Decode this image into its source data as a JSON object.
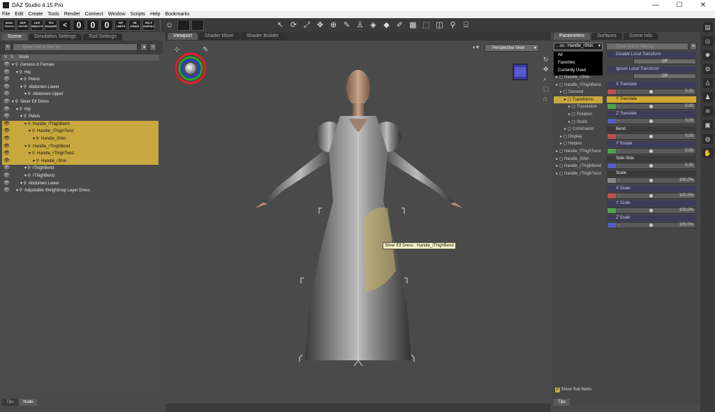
{
  "app": {
    "title": "DAZ Studio 4.15 Pro"
  },
  "window_controls": {
    "minimize": "—",
    "maximize": "☐",
    "close": "✕"
  },
  "menu": [
    "File",
    "Edit",
    "Create",
    "Tools",
    "Render",
    "Connect",
    "Window",
    "Scripts",
    "Help",
    "Bookmarks"
  ],
  "toolbar_buttons": [
    {
      "label": "MAIN TOOLS"
    },
    {
      "label": "MDF CSTOP"
    },
    {
      "label": "LIKE SMOOTH"
    },
    {
      "label": "TEX SHADER"
    },
    {
      "label": "<"
    },
    {
      "label": "0"
    },
    {
      "label": "0"
    },
    {
      "label": "0"
    },
    {
      "label": "HIP LIMITS"
    },
    {
      "label": "SB GRIDS"
    },
    {
      "label": "HELP SURFACE"
    }
  ],
  "left_panel": {
    "tabs": [
      "Scene",
      "Simulation Settings",
      "Tool Settings"
    ],
    "active_tab": "Scene",
    "search_placeholder": "Enter text to filter by",
    "columns": {
      "v": "V",
      "s": "S",
      "node": "Node"
    },
    "tree": [
      {
        "label": "Genesis 8 Female",
        "depth": 0,
        "selected": false
      },
      {
        "label": "Hip",
        "depth": 1,
        "selected": false
      },
      {
        "label": "Pelvis",
        "depth": 2,
        "selected": false
      },
      {
        "label": "Abdomen Lower",
        "depth": 2,
        "selected": false
      },
      {
        "label": "Abdomen Upper",
        "depth": 3,
        "selected": false
      },
      {
        "label": "Silver Elf Dress",
        "depth": 0,
        "selected": false
      },
      {
        "label": "Hip",
        "depth": 1,
        "selected": false
      },
      {
        "label": "Pelvis",
        "depth": 2,
        "selected": false
      },
      {
        "label": "Handle_lThighBend",
        "depth": 3,
        "selected": true
      },
      {
        "label": "Handle_lThighTwist",
        "depth": 4,
        "selected": true
      },
      {
        "label": "Handle_lShin",
        "depth": 5,
        "selected": true
      },
      {
        "label": "Handle_rThighBend",
        "depth": 3,
        "selected": true
      },
      {
        "label": "Handle_rThighTwist",
        "depth": 4,
        "selected": true
      },
      {
        "label": "Handle_rShin",
        "depth": 5,
        "selected": true
      },
      {
        "label": "lThighBend",
        "depth": 3,
        "selected": false
      },
      {
        "label": "rThighBend",
        "depth": 3,
        "selected": false
      },
      {
        "label": "Abdomen Lower",
        "depth": 2,
        "selected": false
      },
      {
        "label": "Adjustable Weightmap Layer Dress",
        "depth": 1,
        "selected": false
      }
    ],
    "bottom_tabs": [
      "Tips",
      "Node"
    ],
    "active_bottom_tab": "Node"
  },
  "viewport": {
    "tabs": [
      "Viewport",
      "Shader Mixer",
      "Shader Builder"
    ],
    "active_tab": "Viewport",
    "view_mode": "Perspective View",
    "tooltip": "Silver Elf Dress : Handle_lThighBend"
  },
  "right_panel": {
    "tabs": [
      "Parameters",
      "Surfaces",
      "Scene Info"
    ],
    "active_tab": "Parameters",
    "node_selector": "...ss : Handle_rShin",
    "search_placeholder": "Enter text to filter by",
    "dropdown": [
      "All",
      "Favorites",
      "Currently Used"
    ],
    "tree": [
      {
        "label": "Handle_rShin",
        "depth": 0,
        "selected": false
      },
      {
        "label": "Handle_lThighBend",
        "depth": 0,
        "selected": false
      },
      {
        "label": "General",
        "depth": 1,
        "selected": false
      },
      {
        "label": "Transforms",
        "depth": 2,
        "selected": true
      },
      {
        "label": "Translation",
        "depth": 3,
        "selected": false
      },
      {
        "label": "Rotation",
        "depth": 3,
        "selected": false
      },
      {
        "label": "Scale",
        "depth": 3,
        "selected": false
      },
      {
        "label": "Constraints",
        "depth": 2,
        "selected": false
      },
      {
        "label": "Display",
        "depth": 1,
        "selected": false
      },
      {
        "label": "Hidden",
        "depth": 1,
        "selected": false
      },
      {
        "label": "Handle_lThighTwist",
        "depth": 0,
        "selected": false
      },
      {
        "label": "Handle_lShin",
        "depth": 0,
        "selected": false
      },
      {
        "label": "Handle_rThighBend",
        "depth": 0,
        "selected": false
      },
      {
        "label": "Handle_rThighTwist",
        "depth": 0,
        "selected": false
      }
    ],
    "properties": [
      {
        "label": "Disable Local Transform",
        "type": "toggle",
        "value": "Off",
        "style": "dim"
      },
      {
        "label": "Ignore Local Transform",
        "type": "toggle",
        "value": "Off",
        "style": "dim"
      },
      {
        "label": "X Translate",
        "type": "slider",
        "value": "0.00",
        "style": "dim",
        "swatch": "#c05050",
        "knob": 0.48
      },
      {
        "label": "Y Translate",
        "type": "slider",
        "value": "0.00",
        "style": "active",
        "swatch": "#50a050",
        "knob": 0.48
      },
      {
        "label": "Z Translate",
        "type": "slider",
        "value": "0.00",
        "style": "dim",
        "swatch": "#5060c0",
        "knob": 0.48
      },
      {
        "label": "Bend",
        "type": "slider",
        "value": "0.00",
        "style": "plain",
        "swatch": "#c05050",
        "knob": 0.48
      },
      {
        "label": "Y Rotate",
        "type": "slider",
        "value": "0.00",
        "style": "dim",
        "swatch": "#50a050",
        "knob": 0.48
      },
      {
        "label": "Side-Side",
        "type": "slider",
        "value": "0.00",
        "style": "plain",
        "swatch": "#5060c0",
        "knob": 0.48
      },
      {
        "label": "Scale",
        "type": "slider",
        "value": "100.0%",
        "style": "plain",
        "swatch": "#888888",
        "knob": 0.48
      },
      {
        "label": "X Scale",
        "type": "slider",
        "value": "100.0%",
        "style": "dim",
        "swatch": "#c05050",
        "knob": 0.48
      },
      {
        "label": "Y Scale",
        "type": "slider",
        "value": "100.0%",
        "style": "dim",
        "swatch": "#50a050",
        "knob": 0.48
      },
      {
        "label": "Z Scale",
        "type": "slider",
        "value": "100.0%",
        "style": "dim",
        "swatch": "#5060c0",
        "knob": 0.48
      }
    ],
    "show_sub_items": "Show Sub Items",
    "bottom_tabs": [
      "Tips"
    ]
  }
}
